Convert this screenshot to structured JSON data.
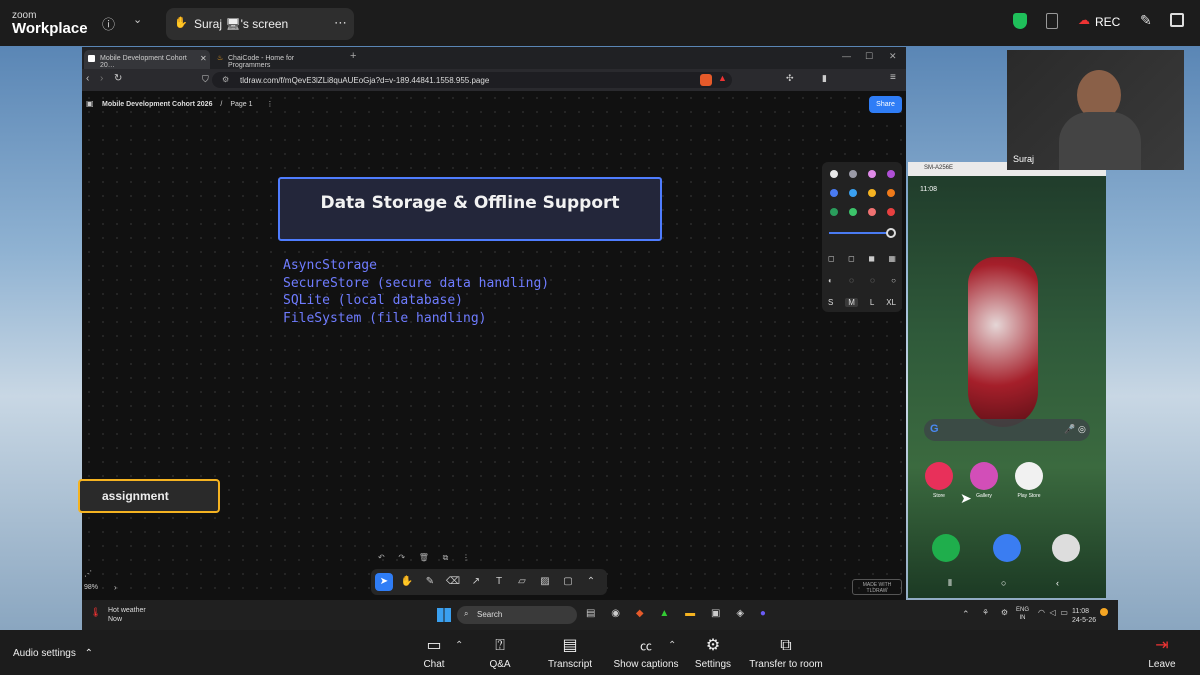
{
  "zoom": {
    "logo_line1": "zoom",
    "logo_line2": "Workplace",
    "share_tab_label": "Suraj 🖥's screen",
    "rec_label": "REC"
  },
  "browser": {
    "tabs": [
      {
        "label": "Mobile Development Cohort 20…"
      },
      {
        "label": "ChaiCode - Home for Programmers"
      }
    ],
    "url": "tldraw.com/f/mQevE3lZLi8quAUEoGja?d=v-189.44841.1558.955.page"
  },
  "tldraw": {
    "breadcrumb_file": "Mobile Development Cohort 2026",
    "breadcrumb_sep": "/",
    "breadcrumb_page": "Page 1",
    "share_label": "Share",
    "title": "Data Storage & Offline Support",
    "topics": [
      "AsyncStorage",
      "SecureStore (secure data handling)",
      "SQLite (local database)",
      "FileSystem (file handling)"
    ],
    "assignment_label": "assignment",
    "zoom_pct": "98%",
    "made_with": "MADE WITH TLDRAW",
    "sizes": [
      "S",
      "M",
      "L",
      "XL"
    ],
    "colors": [
      "#e8e8e8",
      "#9a9aa6",
      "#e08ae8",
      "#b04fd6",
      "#4a7bf2",
      "#3aa0f0",
      "#f5b321",
      "#f07a1a",
      "#2a9d5c",
      "#3cc46a",
      "#f07272",
      "#e84040"
    ]
  },
  "taskbar": {
    "weather_title": "Hot weather",
    "weather_sub": "Now",
    "search_label": "Search",
    "lang1": "ENG",
    "lang2": "IN",
    "time": "11:08",
    "date": "24-5-26"
  },
  "phone": {
    "window_title": "SM-A256E",
    "status_time": "11:08",
    "apps": [
      {
        "label": "Store"
      },
      {
        "label": "Gallery"
      },
      {
        "label": "Play Store"
      }
    ]
  },
  "self_view": {
    "name": "Suraj"
  },
  "bottom_bar": {
    "audio_settings": "Audio settings",
    "chat": "Chat",
    "qa": "Q&A",
    "transcript": "Transcript",
    "captions": "Show captions",
    "settings": "Settings",
    "transfer": "Transfer to room",
    "leave": "Leave"
  }
}
